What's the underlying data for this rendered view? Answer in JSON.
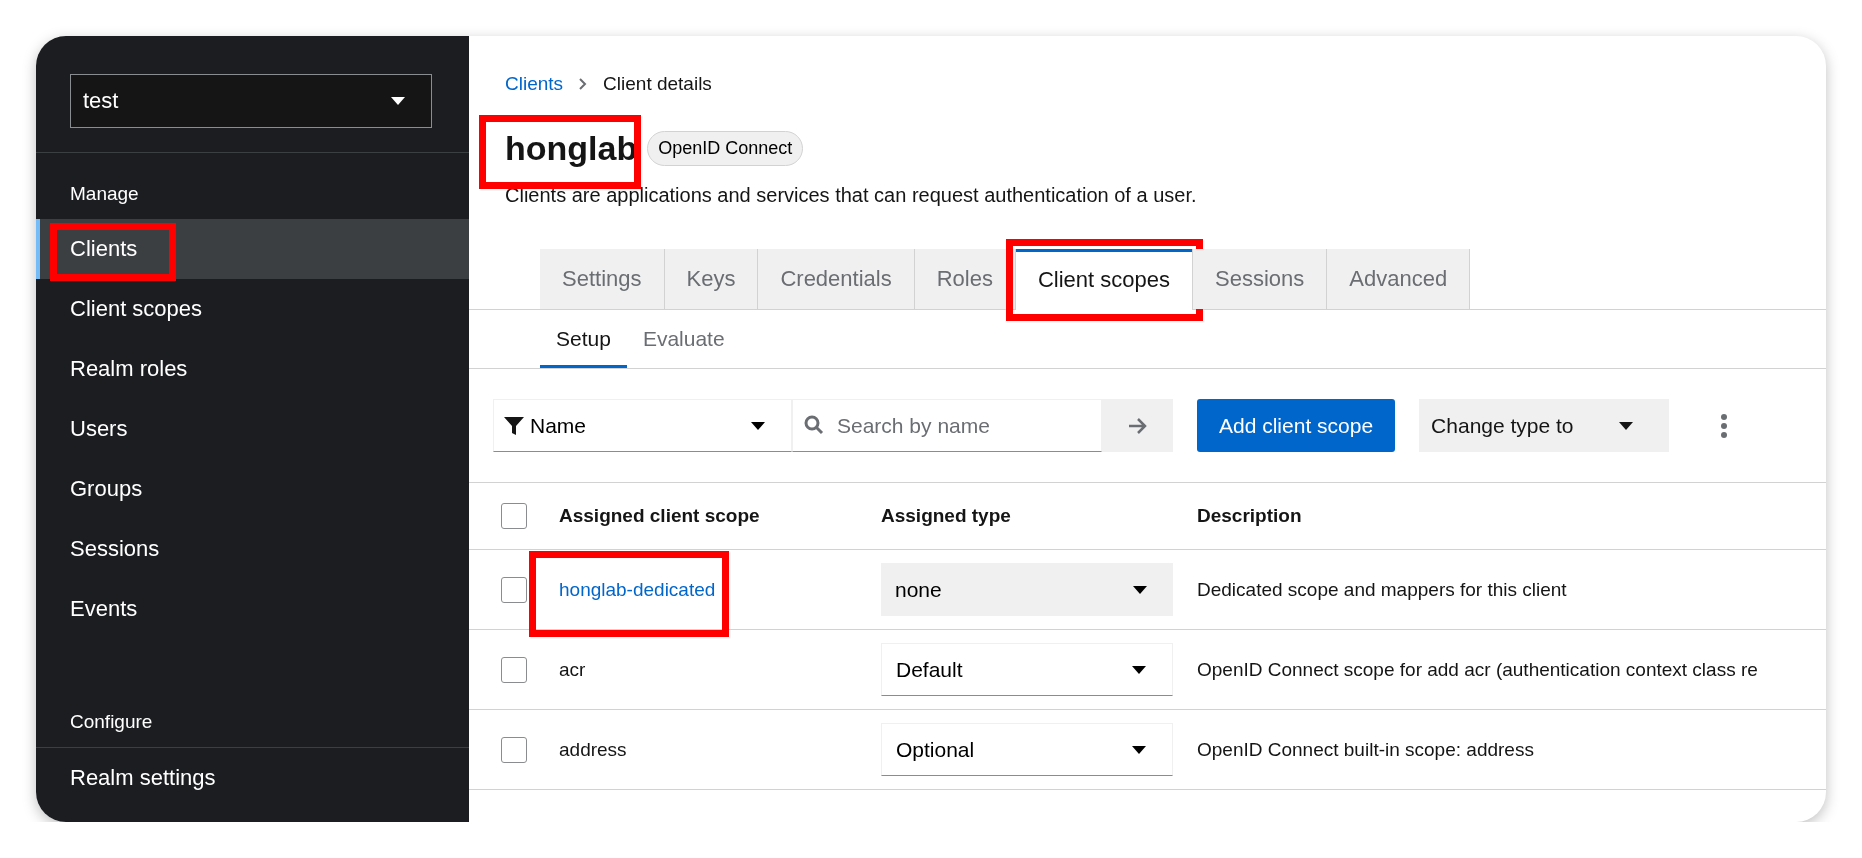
{
  "realm_select": {
    "value": "test"
  },
  "sidebar": {
    "sections": [
      {
        "heading": "Manage",
        "items": [
          {
            "label": "Clients",
            "selected": true,
            "highlighted": true
          },
          {
            "label": "Client scopes",
            "selected": false,
            "highlighted": false
          },
          {
            "label": "Realm roles",
            "selected": false,
            "highlighted": false
          },
          {
            "label": "Users",
            "selected": false,
            "highlighted": false
          },
          {
            "label": "Groups",
            "selected": false,
            "highlighted": false
          },
          {
            "label": "Sessions",
            "selected": false,
            "highlighted": false
          },
          {
            "label": "Events",
            "selected": false,
            "highlighted": false
          }
        ]
      },
      {
        "heading": "Configure",
        "items": [
          {
            "label": "Realm settings",
            "selected": false,
            "highlighted": false
          }
        ]
      }
    ]
  },
  "breadcrumb": [
    {
      "label": "Clients",
      "kind": "link"
    },
    {
      "label": "Client details",
      "kind": "current"
    }
  ],
  "title": {
    "text": "honglab",
    "highlighted": true,
    "badge": "OpenID Connect"
  },
  "description": "Clients are applications and services that can request authentication of a user.",
  "tabs": [
    {
      "label": "Settings",
      "selected": false,
      "highlighted": false
    },
    {
      "label": "Keys",
      "selected": false,
      "highlighted": false
    },
    {
      "label": "Credentials",
      "selected": false,
      "highlighted": false
    },
    {
      "label": "Roles",
      "selected": false,
      "highlighted": false
    },
    {
      "label": "Client scopes",
      "selected": true,
      "highlighted": true
    },
    {
      "label": "Sessions",
      "selected": false,
      "highlighted": false
    },
    {
      "label": "Advanced",
      "selected": false,
      "highlighted": false
    }
  ],
  "subtabs": [
    {
      "label": "Setup",
      "selected": true
    },
    {
      "label": "Evaluate",
      "selected": false
    }
  ],
  "toolbar": {
    "filter": "Name",
    "search_placeholder": "Search by name",
    "add_button": "Add client scope",
    "change_type": "Change type to"
  },
  "table": {
    "select_all_checked": false,
    "columns": [
      "Assigned client scope",
      "Assigned type",
      "Description"
    ],
    "rows": [
      {
        "name": "honglab-dedicated",
        "kind": "link",
        "highlighted": true,
        "type": "none",
        "type_disabled": true,
        "description": "Dedicated scope and mappers for this client",
        "checked": false
      },
      {
        "name": "acr",
        "kind": "text",
        "highlighted": false,
        "type": "Default",
        "type_disabled": false,
        "description": "OpenID Connect scope for add acr (authentication context class re",
        "checked": false
      },
      {
        "name": "address",
        "kind": "text",
        "highlighted": false,
        "type": "Optional",
        "type_disabled": false,
        "description": "OpenID Connect built-in scope: address",
        "checked": false
      }
    ]
  }
}
